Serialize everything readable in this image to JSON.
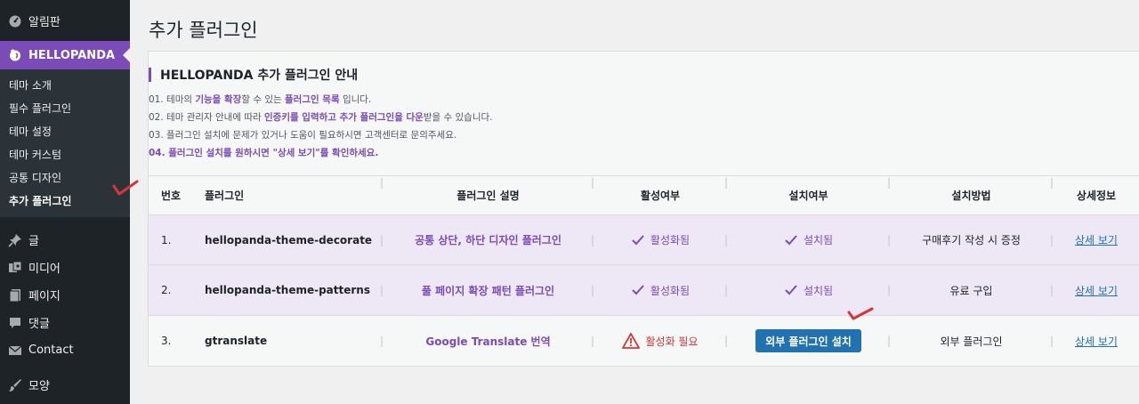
{
  "sidebar": {
    "dashboard": "알림판",
    "brand": "HELLOPANDA",
    "submenu": [
      "테마 소개",
      "필수 플러그인",
      "테마 설정",
      "테마 커스텀",
      "공통 디자인",
      "추가 플러그인"
    ],
    "menu": [
      "글",
      "미디어",
      "페이지",
      "댓글",
      "Contact",
      "모양"
    ],
    "icons": [
      "gauge-icon",
      "panda-icon",
      "pin-icon",
      "media-icon",
      "page-icon",
      "comment-icon",
      "mail-icon",
      "brush-icon"
    ]
  },
  "page": {
    "title": "추가 플러그인",
    "section_title": "HELLOPANDA 추가 플러그인 안내",
    "notes": {
      "n1": {
        "a": "01. 테마의 ",
        "b": "기능을 확장",
        "c": "할 수 있는 ",
        "d": "플러그인 목록",
        "e": " 입니다."
      },
      "n2": {
        "a": "02. 테마 관리자 안내에 따라 ",
        "b": "인증키를 입력하고 추가 플러그인을 다운",
        "c": "받을 수 있습니다."
      },
      "n3": "03. 플러그인 설치에 문제가 있거나 도움이 필요하시면 고객센터로 문의주세요.",
      "n4": "04. 플러그인 설치를 원하시면 \"상세 보기\"를 확인하세요."
    }
  },
  "table": {
    "headers": [
      "번호",
      "플러그인",
      "플러그인 설명",
      "활성여부",
      "설치여부",
      "설치방법",
      "상세정보"
    ],
    "rows": [
      {
        "num": "1.",
        "name": "hellopanda-theme-decorate",
        "desc": "공통 상단, 하단 디자인 플러그인",
        "active": "활성화됨",
        "installed": "설치됨",
        "method": "구매후기 작성 시 증정",
        "detail": "상세 보기"
      },
      {
        "num": "2.",
        "name": "hellopanda-theme-patterns",
        "desc": "풀 페이지 확장 패턴 플러그인",
        "active": "활성화됨",
        "installed": "설치됨",
        "method": "유료 구입",
        "detail": "상세 보기"
      },
      {
        "num": "3.",
        "name": "gtranslate",
        "desc": "Google Translate 번역",
        "active": "활성화 필요",
        "install_button": "외부 플러그인 설치",
        "method": "외부 플러그인",
        "detail": "상세 보기"
      }
    ]
  },
  "colors": {
    "accent": "#7b4bb7",
    "sidebar": "#1d2327",
    "link": "#2271b1",
    "warn": "#d63638"
  }
}
